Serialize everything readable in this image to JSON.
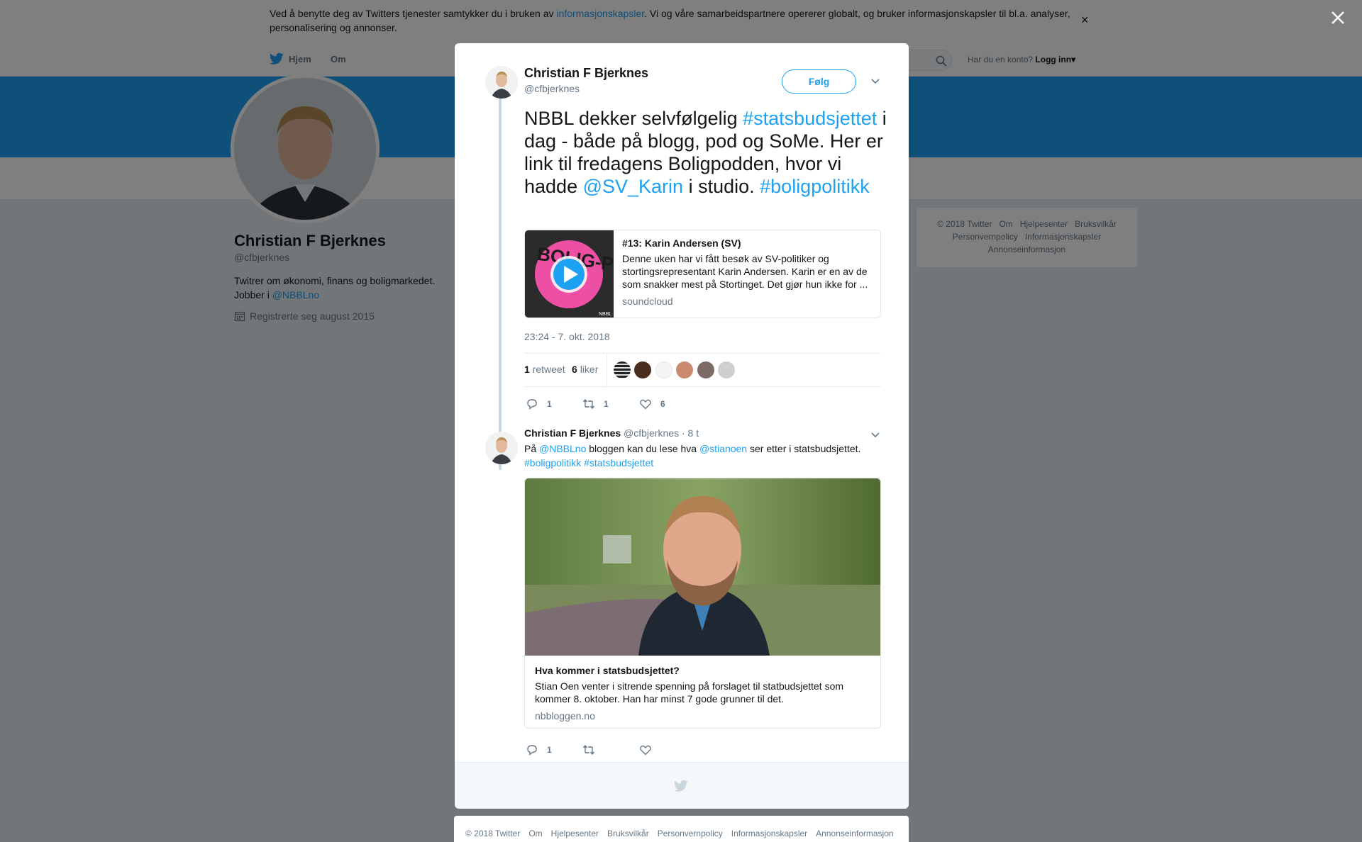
{
  "cookie": {
    "text_before": "Ved å benytte deg av Twitters tjenester samtykker du i bruken av ",
    "link": "informasjonskapsler",
    "text_after": ". Vi og våre samarbeidspartnere opererer globalt, og bruker informasjonskapsler til bl.a. analyser, personalisering og annonser.",
    "close_glyph": "×"
  },
  "nav": {
    "home_label": "Hjem",
    "about_label": "Om",
    "login_prompt": "Har du en konto?",
    "login_label": "Logg inn",
    "login_caret": "▾"
  },
  "profile": {
    "name": "Christian F Bjerknes",
    "handle": "@cfbjerknes",
    "bio_text": "Twitrer om økonomi, finans og boligmarkedet. Jobber i ",
    "bio_link": "@NBBLno",
    "joined": "Registrerte seg august 2015"
  },
  "side_footer": {
    "links": [
      "© 2018 Twitter",
      "Om",
      "Hjelpesenter",
      "Bruksvilkår",
      "Personvernpolicy",
      "Informasjonskapsler",
      "Annonseinformasjon"
    ]
  },
  "tweet": {
    "name": "Christian F Bjerknes",
    "handle": "@cfbjerknes",
    "follow_label": "Følg",
    "text_parts": [
      {
        "t": "NBBL dekker selvfølgelig ",
        "link": false
      },
      {
        "t": "#statsbudsjettet",
        "link": true
      },
      {
        "t": " i dag - både på blogg, pod og SoMe. Her er link til fredagens Boligpodden, hvor vi hadde ",
        "link": false
      },
      {
        "t": "@SV_Karin",
        "link": true
      },
      {
        "t": " i studio. ",
        "link": false
      },
      {
        "t": "#boligpolitikk",
        "link": true
      }
    ],
    "card": {
      "title": "#13: Karin Andersen (SV)",
      "description": "Denne uken har vi fått besøk av SV-politiker og stortingsrepresentant Karin Andersen. Karin er en av de som snakker mest på Stortinget. Det gjør hun ikke for ...",
      "domain": "soundcloud",
      "thumb_text": "BOLIG-PODDEN",
      "thumb_small": "NBBL"
    },
    "timestamp": "23:24 - 7. okt. 2018",
    "retweet_count": "1",
    "retweet_label": "retweet",
    "like_count": "6",
    "like_label": "liker",
    "action_counts": {
      "reply": "1",
      "retweet": "1",
      "like": "6"
    }
  },
  "reply": {
    "name": "Christian F Bjerknes",
    "handle": "@cfbjerknes",
    "time": "· 8 t",
    "text_parts": [
      {
        "t": "På ",
        "link": false
      },
      {
        "t": "@NBBLno",
        "link": true
      },
      {
        "t": " bloggen kan du lese hva ",
        "link": false
      },
      {
        "t": "@stianoen",
        "link": true
      },
      {
        "t": " ser etter i statsbudsjettet. ",
        "link": false
      },
      {
        "t": "#boligpolitikk",
        "link": true
      },
      {
        "t": " ",
        "link": false
      },
      {
        "t": "#statsbudsjettet",
        "link": true
      }
    ],
    "card": {
      "title": "Hva kommer i statsbudsjettet?",
      "description": "Stian Oen venter i sitrende spenning på forslaget til statbudsjettet som kommer 8. oktober. Han har minst 7 gode grunner til det.",
      "domain": "nbbloggen.no"
    },
    "action_counts": {
      "reply": "1",
      "retweet": "",
      "like": ""
    }
  },
  "bottom_footer": {
    "links": [
      "© 2018 Twitter",
      "Om",
      "Hjelpesenter",
      "Bruksvilkår",
      "Personvernpolicy",
      "Informasjonskapsler",
      "Annonseinformasjon"
    ]
  },
  "colors": {
    "accent": "#1da1f2",
    "banner": "#1da1f2",
    "muted": "#657786"
  },
  "icons": [
    "bird-icon",
    "search-icon",
    "close-icon",
    "chevron-down-icon",
    "calendar-icon",
    "reply-icon",
    "retweet-icon",
    "heart-icon",
    "play-icon"
  ]
}
